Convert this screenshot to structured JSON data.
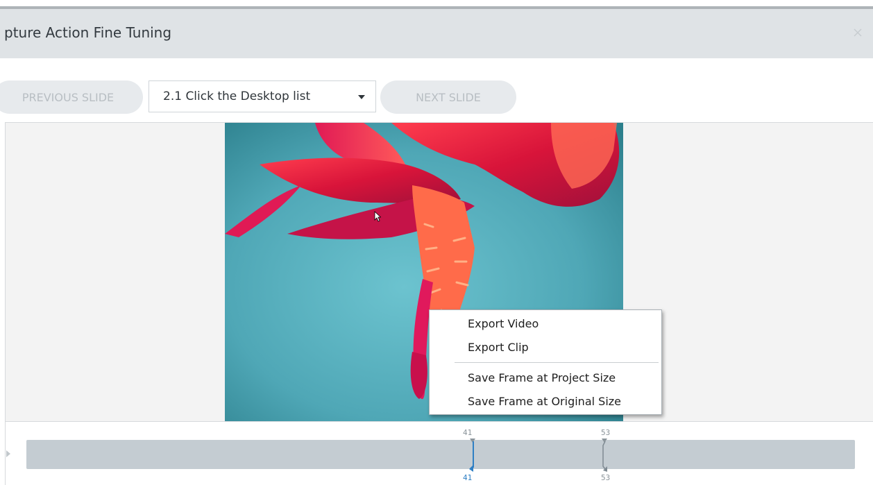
{
  "window": {
    "title": "pture Action Fine Tuning",
    "close_icon": "close-icon"
  },
  "toolbar": {
    "prev_label": "PREVIOUS SLIDE",
    "next_label": "NEXT SLIDE",
    "slide_dropdown": {
      "selected": "2.1 Click the Desktop list",
      "icon": "chevron-down-icon"
    }
  },
  "context_menu": {
    "items": [
      "Export Video",
      "Export Clip",
      "Save Frame at Project Size",
      "Save Frame at Original Size"
    ]
  },
  "timeline": {
    "playhead": {
      "top_label": "41",
      "bottom_label": "41",
      "color": "#2f7fc4"
    },
    "end_marker": {
      "top_label": "53",
      "bottom_label": "53",
      "color": "#7f8a92"
    }
  },
  "colors": {
    "titlebar_bg": "#dfe3e6",
    "button_bg": "#e7eaed",
    "track_bg": "#c4ccd2",
    "photo_bg": "#5fb3c2",
    "flower": "#d8143a"
  }
}
